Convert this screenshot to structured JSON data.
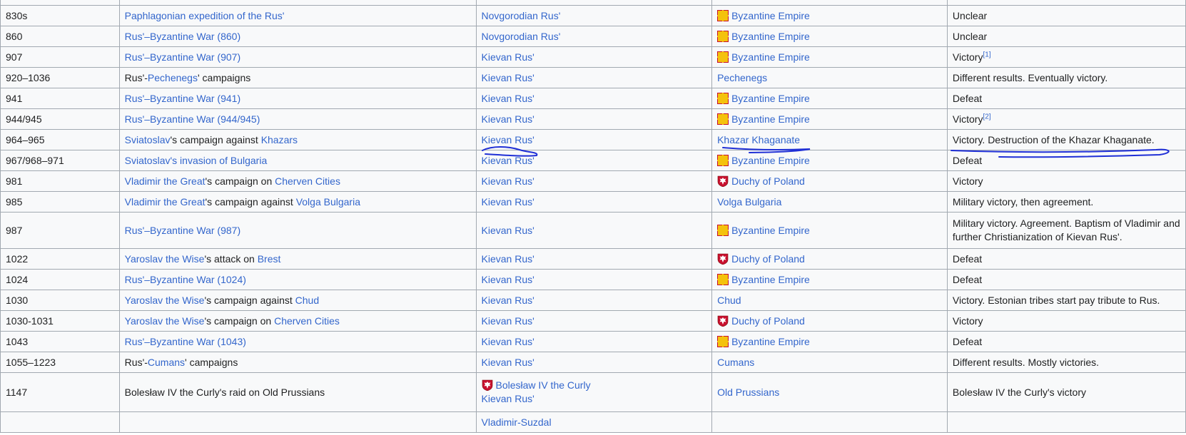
{
  "rows": [
    {
      "date": "830s",
      "war": [
        {
          "t": "Paphlagonian expedition of the Rus'",
          "l": true
        }
      ],
      "ally": {
        "text": "Novgorodian Rus'"
      },
      "enemy": {
        "flag": "byz",
        "text": "Byzantine Empire"
      },
      "result": "Unclear"
    },
    {
      "date": "860",
      "war": [
        {
          "t": "Rus'–Byzantine War (860)",
          "l": true
        }
      ],
      "ally": {
        "text": "Novgorodian Rus'"
      },
      "enemy": {
        "flag": "byz",
        "text": "Byzantine Empire"
      },
      "result": "Unclear"
    },
    {
      "date": "907",
      "war": [
        {
          "t": "Rus'–Byzantine War (907)",
          "l": true
        }
      ],
      "ally": {
        "text": "Kievan Rus'"
      },
      "enemy": {
        "flag": "byz",
        "text": "Byzantine Empire"
      },
      "result": "Victory",
      "sup": "[1]"
    },
    {
      "date": "920–1036",
      "war": [
        {
          "t": "Rus'-",
          "l": false
        },
        {
          "t": "Pechenegs",
          "l": true
        },
        {
          "t": "' campaigns",
          "l": false
        }
      ],
      "ally": {
        "text": "Kievan Rus'"
      },
      "enemy": {
        "text": "Pechenegs"
      },
      "result": "Different results. Eventually victory."
    },
    {
      "date": "941",
      "war": [
        {
          "t": "Rus'–Byzantine War (941)",
          "l": true
        }
      ],
      "ally": {
        "text": "Kievan Rus'"
      },
      "enemy": {
        "flag": "byz",
        "text": "Byzantine Empire"
      },
      "result": "Defeat"
    },
    {
      "date": "944/945",
      "war": [
        {
          "t": "Rus'–Byzantine War (944/945)",
          "l": true
        }
      ],
      "ally": {
        "text": "Kievan Rus'"
      },
      "enemy": {
        "flag": "byz",
        "text": "Byzantine Empire"
      },
      "result": "Victory",
      "sup": "[2]"
    },
    {
      "date": "964–965",
      "war": [
        {
          "t": "Sviatoslav",
          "l": true
        },
        {
          "t": "'s campaign against ",
          "l": false
        },
        {
          "t": "Khazars",
          "l": true
        }
      ],
      "ally": {
        "text": "Kievan Rus'"
      },
      "enemy": {
        "text": "Khazar Khaganate"
      },
      "result": "Victory. Destruction of the Khazar Khaganate."
    },
    {
      "date": "967/968–971",
      "war": [
        {
          "t": "Sviatoslav's invasion of Bulgaria",
          "l": true
        }
      ],
      "ally": {
        "text": "Kievan Rus'"
      },
      "enemy": {
        "flag": "byz",
        "text": "Byzantine Empire"
      },
      "result": "Defeat"
    },
    {
      "date": "981",
      "war": [
        {
          "t": "Vladimir the Great",
          "l": true
        },
        {
          "t": "'s campaign on ",
          "l": false
        },
        {
          "t": "Cherven Cities",
          "l": true
        }
      ],
      "ally": {
        "text": "Kievan Rus'"
      },
      "enemy": {
        "flag": "pol",
        "text": "Duchy of Poland"
      },
      "result": "Victory"
    },
    {
      "date": "985",
      "war": [
        {
          "t": "Vladimir the Great",
          "l": true
        },
        {
          "t": "'s campaign against ",
          "l": false
        },
        {
          "t": "Volga Bulgaria",
          "l": true
        }
      ],
      "ally": {
        "text": "Kievan Rus'"
      },
      "enemy": {
        "text": "Volga Bulgaria"
      },
      "result": "Military victory, then agreement."
    },
    {
      "date": "987",
      "war": [
        {
          "t": "Rus'–Byzantine War (987)",
          "l": true
        }
      ],
      "ally": {
        "text": "Kievan Rus'"
      },
      "enemy": {
        "flag": "byz",
        "text": "Byzantine Empire"
      },
      "result": "Military victory. Agreement. Baptism of Vladimir and further Christianization of Kievan Rus'.",
      "cls": "tall"
    },
    {
      "date": "1022",
      "war": [
        {
          "t": "Yaroslav the Wise",
          "l": true
        },
        {
          "t": "'s attack on ",
          "l": false
        },
        {
          "t": "Brest",
          "l": true
        }
      ],
      "ally": {
        "text": "Kievan Rus'"
      },
      "enemy": {
        "flag": "pol",
        "text": "Duchy of Poland"
      },
      "result": "Defeat"
    },
    {
      "date": "1024",
      "war": [
        {
          "t": "Rus'–Byzantine War (1024)",
          "l": true
        }
      ],
      "ally": {
        "text": "Kievan Rus'"
      },
      "enemy": {
        "flag": "byz",
        "text": "Byzantine Empire"
      },
      "result": "Defeat"
    },
    {
      "date": "1030",
      "war": [
        {
          "t": "Yaroslav the Wise",
          "l": true
        },
        {
          "t": "'s campaign against ",
          "l": false
        },
        {
          "t": "Chud",
          "l": true
        }
      ],
      "ally": {
        "text": "Kievan Rus'"
      },
      "enemy": {
        "text": "Chud"
      },
      "result": "Victory. Estonian tribes start pay tribute to Rus."
    },
    {
      "date": "1030-1031",
      "war": [
        {
          "t": "Yaroslav the Wise",
          "l": true
        },
        {
          "t": "'s campaign on ",
          "l": false
        },
        {
          "t": "Cherven Cities",
          "l": true
        }
      ],
      "ally": {
        "text": "Kievan Rus'"
      },
      "enemy": {
        "flag": "pol",
        "text": "Duchy of Poland"
      },
      "result": "Victory"
    },
    {
      "date": "1043",
      "war": [
        {
          "t": "Rus'–Byzantine War (1043)",
          "l": true
        }
      ],
      "ally": {
        "text": "Kievan Rus'"
      },
      "enemy": {
        "flag": "byz",
        "text": "Byzantine Empire"
      },
      "result": "Defeat"
    },
    {
      "date": "1055–1223",
      "war": [
        {
          "t": "Rus'-",
          "l": false
        },
        {
          "t": "Cumans",
          "l": true
        },
        {
          "t": "' campaigns",
          "l": false
        }
      ],
      "ally": {
        "text": "Kievan Rus'"
      },
      "enemy": {
        "text": "Cumans"
      },
      "result": "Different results. Mostly victories."
    },
    {
      "date": "1147",
      "war": [
        {
          "t": "Bolesław IV the Curly's raid on Old Prussians",
          "l": false
        }
      ],
      "ally": {
        "flag": "pol",
        "text": "Bolesław IV the Curly",
        "text2": "Kievan Rus'"
      },
      "enemy": {
        "text": "Old Prussians"
      },
      "result": "Bolesław IV the Curly's victory",
      "cls": "tall2"
    },
    {
      "date": "",
      "war": [],
      "ally": {
        "text": "Vladimir-Suzdal"
      },
      "enemy": {
        "text": ""
      },
      "result": ""
    }
  ],
  "flag_colors": {
    "byz_red": "#c8102e",
    "byz_gold": "#f4c20d",
    "pol_red": "#c8102e",
    "pol_white": "#ffffff"
  },
  "annotation_color": "#1f2fd6"
}
